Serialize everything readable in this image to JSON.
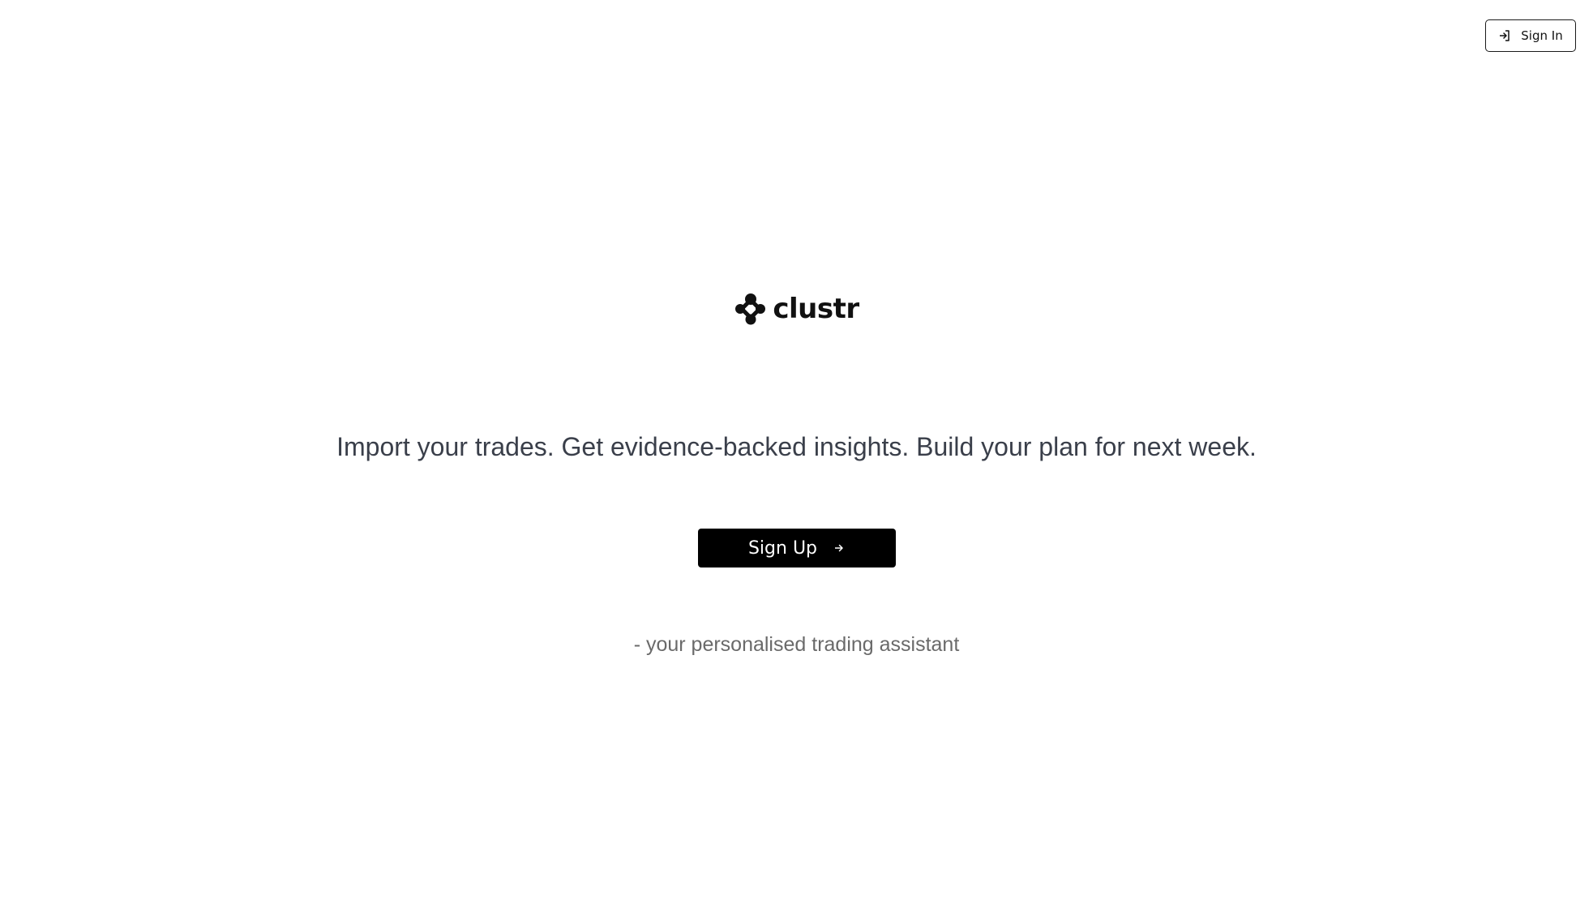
{
  "header": {
    "sign_in_label": "Sign In",
    "sign_in_icon": "sign-in-icon"
  },
  "brand": {
    "name": "clustr",
    "logo_icon": "cluster-logo-icon"
  },
  "hero": {
    "tagline": "Import your trades. Get evidence-backed insights. Build your plan for next week.",
    "sign_up_label": "Sign Up",
    "sign_up_icon": "arrow-right-icon",
    "subtitle": "- your personalised trading assistant"
  },
  "colors": {
    "background": "#ffffff",
    "primary_button": "#000000",
    "primary_button_text": "#ffffff",
    "tagline_text": "#3a3f4a",
    "subtitle_text": "#6a6a6a"
  }
}
